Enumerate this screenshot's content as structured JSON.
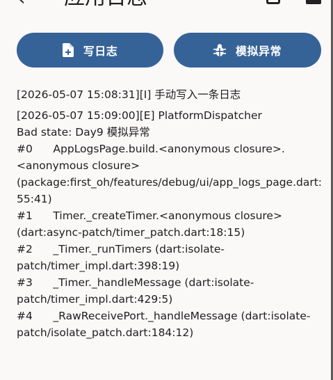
{
  "appbar": {
    "back_glyph": "‹",
    "title": "应用日志",
    "icons": [
      "copy-icon",
      "more-icon"
    ]
  },
  "buttons": {
    "write_label": "写日志",
    "write_icon": "note-add-icon",
    "crash_label": "模拟异常",
    "crash_icon": "bug-icon"
  },
  "colors": {
    "button_bg": "#366397",
    "button_text": "#ffffff",
    "page_bg": "#fbf8f8",
    "text": "#1e1e1e"
  },
  "logs": [
    "[2026-05-07 15:08:31][I] 手动写入一条日志",
    "[2026-05-07 15:09:00][E] PlatformDispatcher\nBad state: Day9 模拟异常\n#0      AppLogsPage.build.<anonymous closure>.<anonymous closure> (package:first_oh/features/debug/ui/app_logs_page.dart:55:41)\n#1      Timer._createTimer.<anonymous closure> (dart:async-patch/timer_patch.dart:18:15)\n#2      _Timer._runTimers (dart:isolate-patch/timer_impl.dart:398:19)\n#3      _Timer._handleMessage (dart:isolate-patch/timer_impl.dart:429:5)\n#4      _RawReceivePort._handleMessage (dart:isolate-patch/isolate_patch.dart:184:12)"
  ]
}
